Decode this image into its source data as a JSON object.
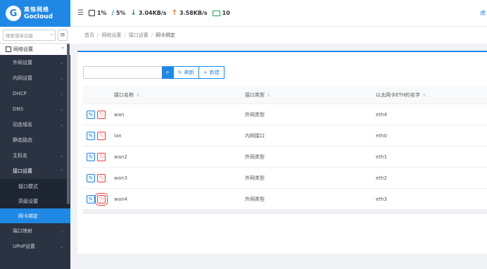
{
  "brand": {
    "name_cn": "高恪网络",
    "name_en": "Gocloud",
    "logo_letter": "G"
  },
  "sidebar": {
    "search_placeholder": "搜索菜单功能",
    "group_label": "网络设置",
    "items": [
      {
        "label": "外网设置",
        "chev": "⌄"
      },
      {
        "label": "内网设置",
        "chev": "⌄"
      },
      {
        "label": "DHCP",
        "chev": "⌄"
      },
      {
        "label": "DNS",
        "chev": "⌄"
      },
      {
        "label": "动态域名",
        "chev": "⌄"
      },
      {
        "label": "静态路由",
        "chev": ""
      },
      {
        "label": "主机名",
        "chev": "⌄"
      },
      {
        "label": "接口设置",
        "chev": "⌃"
      }
    ],
    "subitems": [
      {
        "label": "接口模式"
      },
      {
        "label": "高级设置"
      },
      {
        "label": "网卡绑定"
      }
    ],
    "after_items": [
      {
        "label": "端口映射",
        "chev": "⌄"
      },
      {
        "label": "UPnP设置",
        "chev": "⌄"
      }
    ]
  },
  "topbar": {
    "cpu": "1%",
    "mem": "5%",
    "down": "3.04KB/s",
    "up": "3.58KB/s",
    "clients": "10",
    "right_text": "虑"
  },
  "breadcrumb": [
    "首页",
    "网络设置",
    "接口设置",
    "网卡绑定"
  ],
  "toolbar": {
    "refresh_label": "刷新",
    "new_label": "新建",
    "search_value": ""
  },
  "table": {
    "headers": [
      "接口名称",
      "接口类型",
      "以太网卡ETH的名字"
    ],
    "rows": [
      {
        "name": "wan",
        "type": "外网类型",
        "eth": "eth4"
      },
      {
        "name": "lan",
        "type": "内网接口",
        "eth": "eth0"
      },
      {
        "name": "wan2",
        "type": "外网类型",
        "eth": "eth1"
      },
      {
        "name": "wan3",
        "type": "外网类型",
        "eth": "eth2"
      },
      {
        "name": "wan4",
        "type": "外网类型",
        "eth": "eth3"
      }
    ]
  },
  "colors": {
    "accent": "#1f88e5",
    "sidebar_bg": "#2b3342",
    "danger": "#ef4444"
  }
}
